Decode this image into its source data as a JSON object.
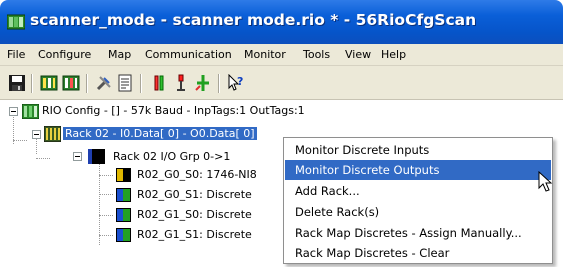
{
  "window": {
    "title": "scanner_mode - scanner mode.rio * - 56RioCfgScan"
  },
  "menubar": {
    "items": [
      {
        "label": "File"
      },
      {
        "label": "Configure"
      },
      {
        "label": "Map"
      },
      {
        "label": "Communication"
      },
      {
        "label": "Monitor"
      },
      {
        "label": "Tools"
      },
      {
        "label": "View"
      },
      {
        "label": "Help"
      }
    ]
  },
  "toolbar": {
    "buttons": [
      {
        "icon": "save-icon"
      },
      {
        "icon": "rack-config-icon"
      },
      {
        "icon": "rack-map-icon"
      },
      {
        "icon": "tools-icon"
      },
      {
        "icon": "report-icon"
      },
      {
        "icon": "monitor-inputs-icon"
      },
      {
        "icon": "monitor-outputs-icon"
      },
      {
        "icon": "io-map-icon"
      },
      {
        "icon": "context-help-icon"
      }
    ]
  },
  "tree": {
    "root": "RIO Config - [] -  57k Baud - InpTags:1 OutTags:1",
    "rack": "Rack 02 - I0.Data[  0] - O0.Data[  0]",
    "group": "Rack 02 I/O Grp 0->1",
    "slots": [
      {
        "label": "R02_G0_S0: 1746-NI8",
        "color": "#e0b800"
      },
      {
        "label": "R02_G0_S1: Discrete",
        "color": "#1a4fd0"
      },
      {
        "label": "R02_G1_S0: Discrete",
        "color": "#1a4fd0"
      },
      {
        "label": "R02_G1_S1: Discrete",
        "color": "#1a4fd0"
      }
    ]
  },
  "context_menu": {
    "items": [
      {
        "label": "Monitor Discrete Inputs",
        "highlighted": false
      },
      {
        "label": "Monitor Discrete Outputs",
        "highlighted": true
      },
      {
        "label": "Add Rack...",
        "highlighted": false
      },
      {
        "label": "Delete Rack(s)",
        "highlighted": false
      },
      {
        "label": "Rack Map Discretes - Assign Manually...",
        "highlighted": false
      },
      {
        "label": "Rack Map Discretes - Clear",
        "highlighted": false
      }
    ]
  },
  "colors": {
    "titlebar": "#0654c9",
    "selection": "#316ac5",
    "menubar": "#ece9d8"
  }
}
